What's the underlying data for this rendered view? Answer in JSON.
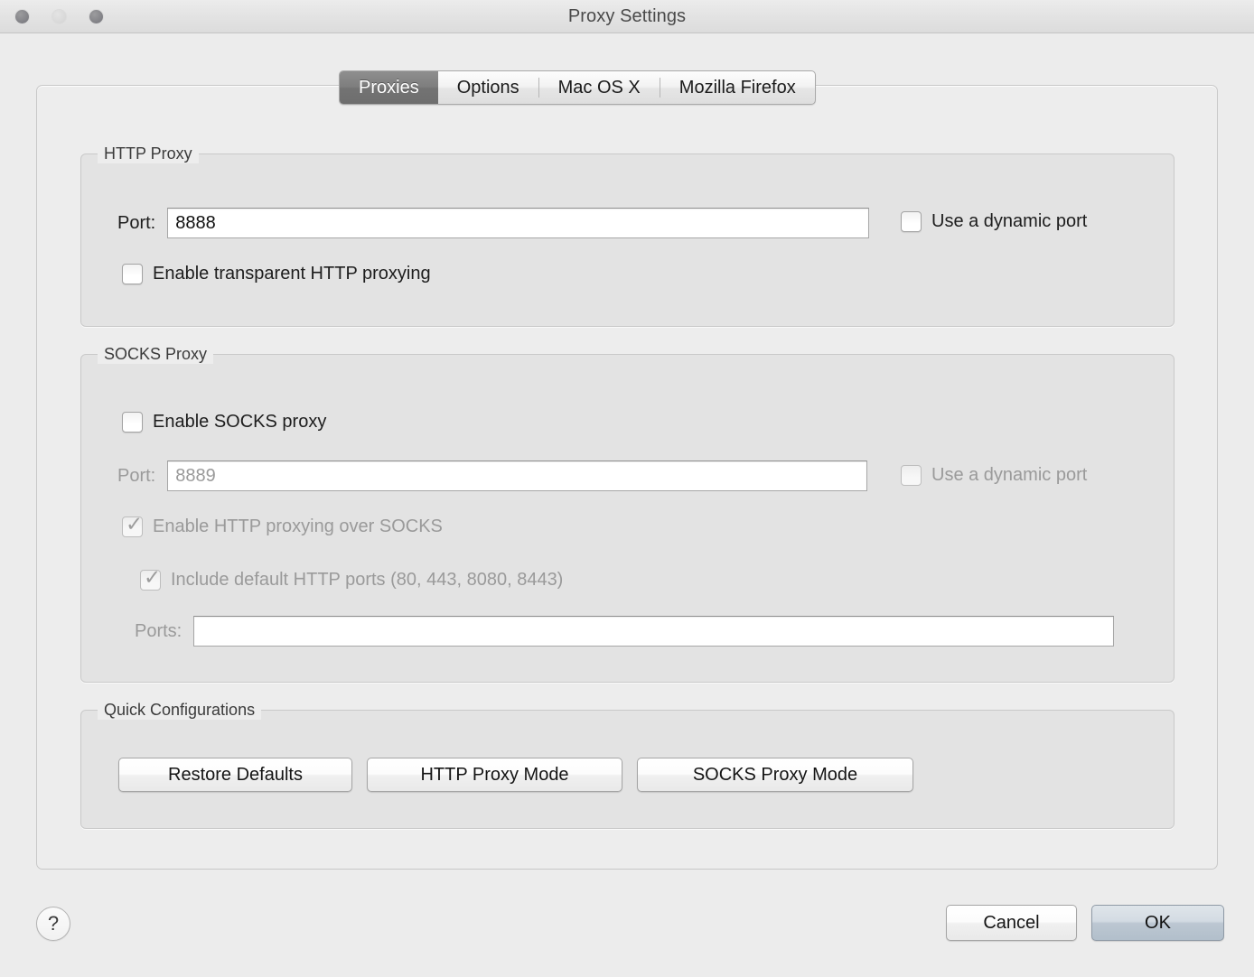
{
  "window": {
    "title": "Proxy Settings",
    "traffic_lights": [
      "close",
      "minimize",
      "zoom"
    ]
  },
  "tabs": [
    {
      "label": "Proxies",
      "selected": true
    },
    {
      "label": "Options",
      "selected": false
    },
    {
      "label": "Mac OS X",
      "selected": false
    },
    {
      "label": "Mozilla Firefox",
      "selected": false
    }
  ],
  "http_proxy": {
    "group_title": "HTTP Proxy",
    "port_label": "Port:",
    "port_value": "8888",
    "port_placeholder": "",
    "dynamic_port_label": "Use a dynamic port",
    "dynamic_port_checked": false,
    "transparent_label": "Enable transparent HTTP proxying",
    "transparent_checked": false
  },
  "socks_proxy": {
    "group_title": "SOCKS Proxy",
    "enable_label": "Enable SOCKS proxy",
    "enable_checked": false,
    "port_label": "Port:",
    "port_value": "8889",
    "port_disabled": true,
    "dynamic_port_label": "Use a dynamic port",
    "dynamic_port_checked": false,
    "dynamic_port_disabled": true,
    "http_over_socks_label": "Enable HTTP proxying over SOCKS",
    "http_over_socks_checked": true,
    "http_over_socks_disabled": true,
    "include_defaults_label": "Include default HTTP ports (80, 443, 8080, 8443)",
    "include_defaults_checked": true,
    "include_defaults_disabled": true,
    "ports_label": "Ports:",
    "ports_value": "",
    "ports_disabled": true
  },
  "quick_configurations": {
    "group_title": "Quick Configurations",
    "restore_defaults": "Restore Defaults",
    "http_proxy_mode": "HTTP Proxy Mode",
    "socks_proxy_mode": "SOCKS Proxy Mode"
  },
  "footer": {
    "help_glyph": "?",
    "cancel_label": "Cancel",
    "ok_label": "OK"
  },
  "glyphs": {
    "check": "✓"
  },
  "colors": {
    "window_bg": "#ececec",
    "panel_bg": "#ededed",
    "group_bg": "#e3e3e3",
    "selected_tab_bg": "#7b7b7b",
    "default_button_bg": "#c5cfd9",
    "text": "#1d1d1d",
    "disabled_text": "#9a9a9a"
  }
}
